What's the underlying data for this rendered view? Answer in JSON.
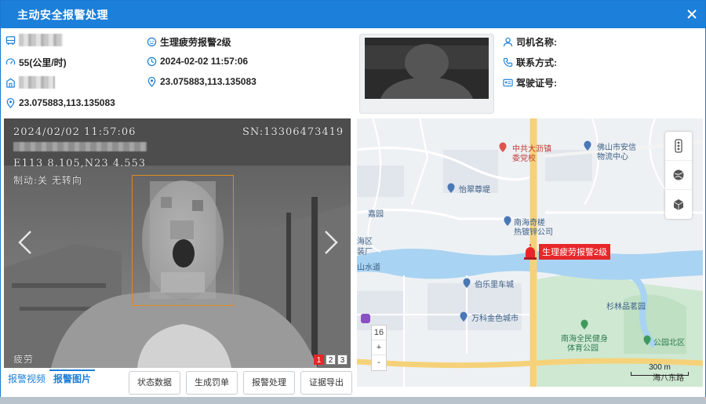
{
  "dialog": {
    "title": "主动安全报警处理"
  },
  "info": {
    "alarm_type": "生理疲劳报警2级",
    "speed": "55(公里/时)",
    "alarm_time": "2024-02-02 11:57:06",
    "position_right": "23.075883,113.135083",
    "position_left": "23.075883,113.135083"
  },
  "driver": {
    "name_label": "司机名称:",
    "phone_label": "联系方式:",
    "license_label": "驾驶证号:"
  },
  "photo": {
    "osd_datetime": "2024/02/02 11:57:06",
    "osd_sn": "SN:13306473419",
    "osd_coords": "E113 8.105,N23 4.553",
    "osd_brake": "制动:关 无转向",
    "osd_status": "疲劳",
    "pages": [
      "1",
      "2",
      "3"
    ],
    "active_page": "1"
  },
  "map": {
    "labels": {
      "party": "中共大沥镇",
      "party2": "委党校",
      "xinyi": "佛山市安信",
      "xinyi2": "物流中心",
      "yicui": "怡翠尊堤",
      "jiayuan": "嘉园",
      "nanhai": "南海奇槎",
      "nanhai2": "热镀锌公司",
      "haiqu": "海区",
      "zhuangchang": "装厂",
      "shanshuidao": "山水道",
      "boletcheng": "伯乐里车城",
      "wanke": "万科金色城市",
      "shanlin": "杉林品茗园",
      "tiyu": "南海全民健身",
      "tiyu2": "体育公园",
      "gongyuan": "公园北区",
      "road": "海八东路"
    },
    "alarm_tag": "生理疲劳报警2级",
    "zoom_level": "16",
    "zoom_in": "+",
    "zoom_out": "-",
    "scale": "300 m"
  },
  "tabs": [
    "报警视频",
    "报警图片"
  ],
  "active_tab": "报警图片",
  "buttons": [
    "状态数据",
    "生成罚单",
    "报警处理",
    "证据导出"
  ],
  "colors": {
    "accent": "#1c7fd9",
    "alarm": "#e8262a",
    "face_box": "#e08a1e"
  }
}
